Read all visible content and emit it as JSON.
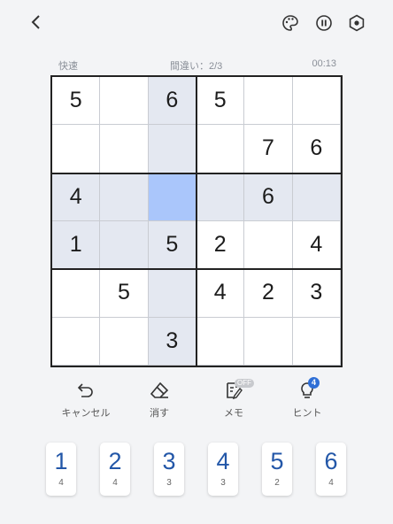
{
  "status": {
    "mode": "快速",
    "mistakes": "間違い：2/3",
    "time": "00:13"
  },
  "icons": {
    "back": "chevron-left-icon",
    "theme": "palette-icon",
    "pause": "pause-icon",
    "settings": "gear-icon"
  },
  "board": {
    "size": 6,
    "selected": [
      2,
      2
    ],
    "cells": [
      [
        "5",
        "",
        "6",
        "5",
        "",
        ""
      ],
      [
        "",
        "",
        "",
        "",
        "7",
        "6"
      ],
      [
        "4",
        "",
        "",
        "",
        "6",
        ""
      ],
      [
        "1",
        "",
        "5",
        "2",
        "",
        "4"
      ],
      [
        "",
        "5",
        "",
        "4",
        "2",
        "3"
      ],
      [
        "",
        "",
        "3",
        "",
        "",
        ""
      ]
    ]
  },
  "tools": {
    "undo_label": "キャンセル",
    "erase_label": "消す",
    "memo_label": "メモ",
    "memo_state": "OFF",
    "hint_label": "ヒント",
    "hint_count": "4"
  },
  "numpad": [
    {
      "num": "1",
      "count": "4"
    },
    {
      "num": "2",
      "count": "4"
    },
    {
      "num": "3",
      "count": "3"
    },
    {
      "num": "4",
      "count": "3"
    },
    {
      "num": "5",
      "count": "2"
    },
    {
      "num": "6",
      "count": "4"
    }
  ],
  "colors": {
    "accent": "#2357a8",
    "highlight": "#e4e8f1",
    "selected": "#aac6fb",
    "badge": "#2f6fd6"
  }
}
